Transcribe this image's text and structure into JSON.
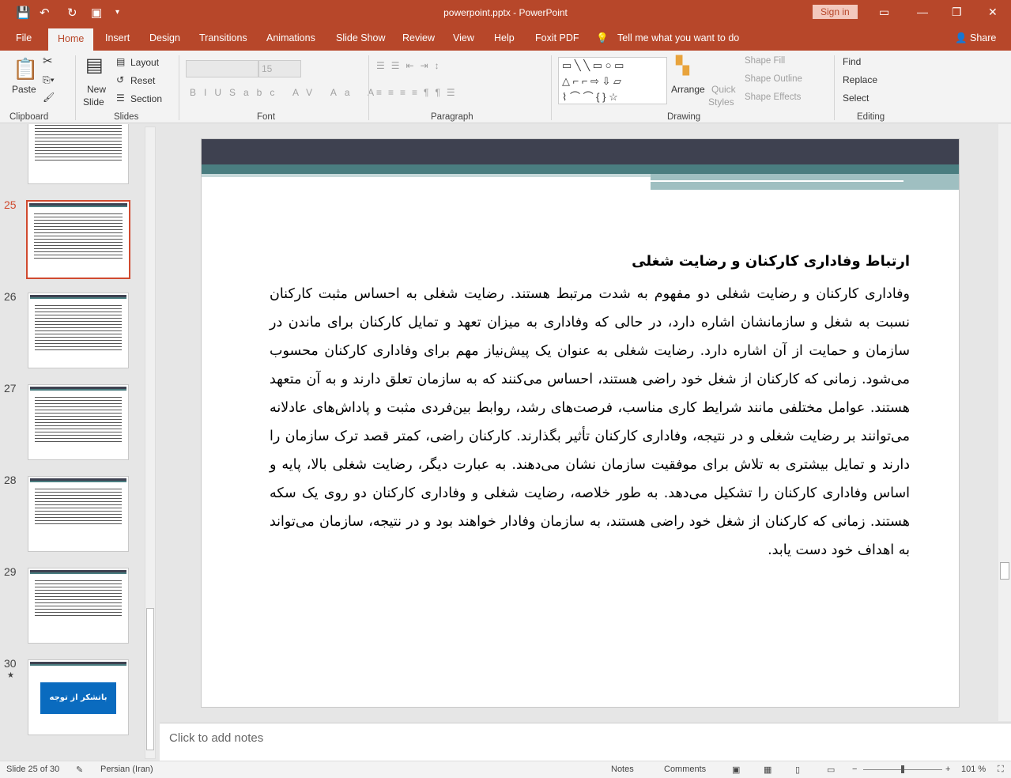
{
  "window": {
    "title": "powerpoint.pptx  -  PowerPoint",
    "sign_in": "Sign in",
    "share": "Share"
  },
  "tabs": [
    "File",
    "Home",
    "Insert",
    "Design",
    "Transitions",
    "Animations",
    "Slide Show",
    "Review",
    "View",
    "Help",
    "Foxit PDF"
  ],
  "tell_me": "Tell me what you want to do",
  "ribbon": {
    "clipboard": {
      "label": "Clipboard",
      "paste": "Paste"
    },
    "slides": {
      "label": "Slides",
      "new_slide": "New",
      "new_slide2": "Slide",
      "layout": "Layout",
      "reset": "Reset",
      "section": "Section"
    },
    "font": {
      "label": "Font",
      "size": "15"
    },
    "paragraph": {
      "label": "Paragraph"
    },
    "drawing": {
      "label": "Drawing",
      "arrange": "Arrange",
      "quick_styles": "Quick",
      "quick_styles2": "Styles",
      "shape_fill": "Shape Fill",
      "shape_outline": "Shape Outline",
      "shape_effects": "Shape Effects"
    },
    "editing": {
      "label": "Editing",
      "find": "Find",
      "replace": "Replace",
      "select": "Select"
    }
  },
  "thumbnails": [
    {
      "num": "25"
    },
    {
      "num": "26"
    },
    {
      "num": "27"
    },
    {
      "num": "28"
    },
    {
      "num": "29"
    },
    {
      "num": "30",
      "button": "باتشکر از توجه شما"
    }
  ],
  "slide": {
    "title": "ارتباط وفاداری کارکنان و رضایت شغلی",
    "body": "وفاداری کارکنان و رضایت شغلی دو مفهوم به شدت مرتبط هستند. رضایت شغلی به احساس مثبت کارکنان نسبت به شغل و سازمانشان اشاره دارد، در حالی که وفاداری به میزان تعهد و تمایل کارکنان برای ماندن در سازمان و حمایت از آن اشاره دارد. رضایت شغلی به عنوان یک پیش‌نیاز مهم برای وفاداری کارکنان محسوب می‌شود. زمانی که کارکنان از شغل خود راضی هستند، احساس می‌کنند که به سازمان تعلق دارند و به آن متعهد هستند. عوامل مختلفی مانند شرایط کاری مناسب، فرصت‌های رشد، روابط بین‌فردی مثبت و پاداش‌های عادلانه می‌توانند بر رضایت شغلی و در نتیجه، وفاداری کارکنان تأثیر بگذارند. کارکنان راضی، کمتر قصد ترک سازمان را دارند و تمایل بیشتری به تلاش برای موفقیت سازمان نشان می‌دهند. به عبارت دیگر، رضایت شغلی بالا، پایه و اساس وفاداری کارکنان را تشکیل می‌دهد. به طور خلاصه، رضایت شغلی و وفاداری کارکنان دو روی یک سکه هستند. زمانی که کارکنان از شغل خود راضی هستند، به سازمان وفادار خواهند بود و در نتیجه، سازمان می‌تواند به اهداف خود دست یابد."
  },
  "notes_placeholder": "Click to add notes",
  "status": {
    "slide": "Slide 25 of 30",
    "language": "Persian (Iran)",
    "notes": "Notes",
    "comments": "Comments",
    "zoom": "101 %"
  },
  "colors": {
    "accent": "#b7472a",
    "slide_header": "#3e4150",
    "slide_band": "#4a7d80"
  }
}
